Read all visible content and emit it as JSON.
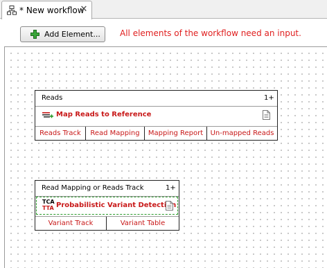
{
  "tab": {
    "title": "* New workflow",
    "close_symbol": "✕",
    "icon": "workflow-icon"
  },
  "toolbar": {
    "add_element_label": "Add Element...",
    "warning": "All elements of the workflow need an input."
  },
  "elements": [
    {
      "header": "Reads",
      "count": "1+",
      "tool": "Map Reads to Reference",
      "tool_icon": "map-reads-icon",
      "outputs": [
        "Reads Track",
        "Read Mapping",
        "Mapping Report",
        "Un-mapped Reads"
      ]
    },
    {
      "header": "Read Mapping or Reads Track",
      "count": "1+",
      "tool": "Probabilistic Variant Detection",
      "tool_icon": "variant-detection-icon",
      "tool_icon_text": [
        "TCA",
        "TTA"
      ],
      "outputs": [
        "Variant Track",
        "Variant Table"
      ]
    }
  ],
  "colors": {
    "error_red": "#e02020",
    "output_red": "#c81818",
    "selection_green": "#2a9a2a"
  }
}
